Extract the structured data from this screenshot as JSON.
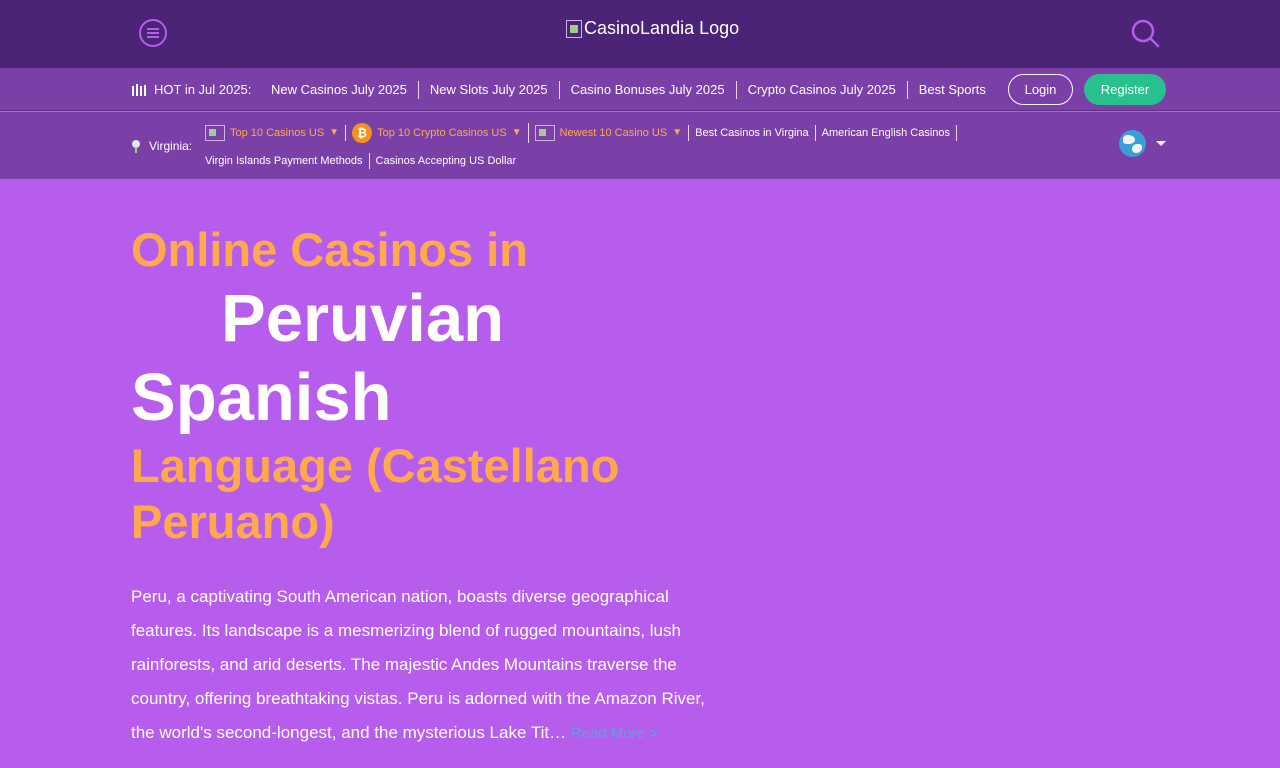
{
  "header": {
    "logo_alt": "CasinoLandia Logo"
  },
  "hotbar": {
    "label": "HOT in Jul 2025:",
    "links": [
      "New Casinos July 2025",
      "New Slots July 2025",
      "Casino Bonuses July 2025",
      "Crypto Casinos July 2025",
      "Best Sports B"
    ],
    "login": "Login",
    "register": "Register"
  },
  "region": {
    "label": "Virginia:",
    "links_row1": [
      {
        "text": "Top 10 Casinos US",
        "icon": "flag-image-icon",
        "dropdown": true
      },
      {
        "text": "Top 10 Crypto Casinos US",
        "icon": "bitcoin-icon",
        "dropdown": true
      },
      {
        "text": "Newest 10 Casino US",
        "icon": "flag-image-icon",
        "dropdown": true
      },
      {
        "text": "Best Casinos in Virgina"
      },
      {
        "text": "American English Casinos"
      }
    ],
    "links_row2": [
      "Virgin Islands Payment Methods",
      "Casinos Accepting US Dollar"
    ]
  },
  "hero": {
    "line1": "Online Casinos in",
    "line2": "Peruvian",
    "line3": "Spanish",
    "line4": "Language (Castellano",
    "line5": "Peruano)",
    "text": "Peru, a captivating South American nation, boasts diverse geographical features. Its landscape is a mesmerizing blend of rugged mountains, lush rainforests, and arid deserts. The majestic Andes Mountains traverse the country, offering breathtaking vistas. Peru is adorned with the Amazon River, the world's second-longest, and the mysterious Lake Tit…",
    "read_more": "Read More >"
  },
  "colors": {
    "header_bg": "#4b2478",
    "nav_bg": "#7b3fa8",
    "page_bg": "#b65ded",
    "accent": "#ffa94d",
    "register": "#28c08e",
    "link": "#5aa0e6"
  }
}
